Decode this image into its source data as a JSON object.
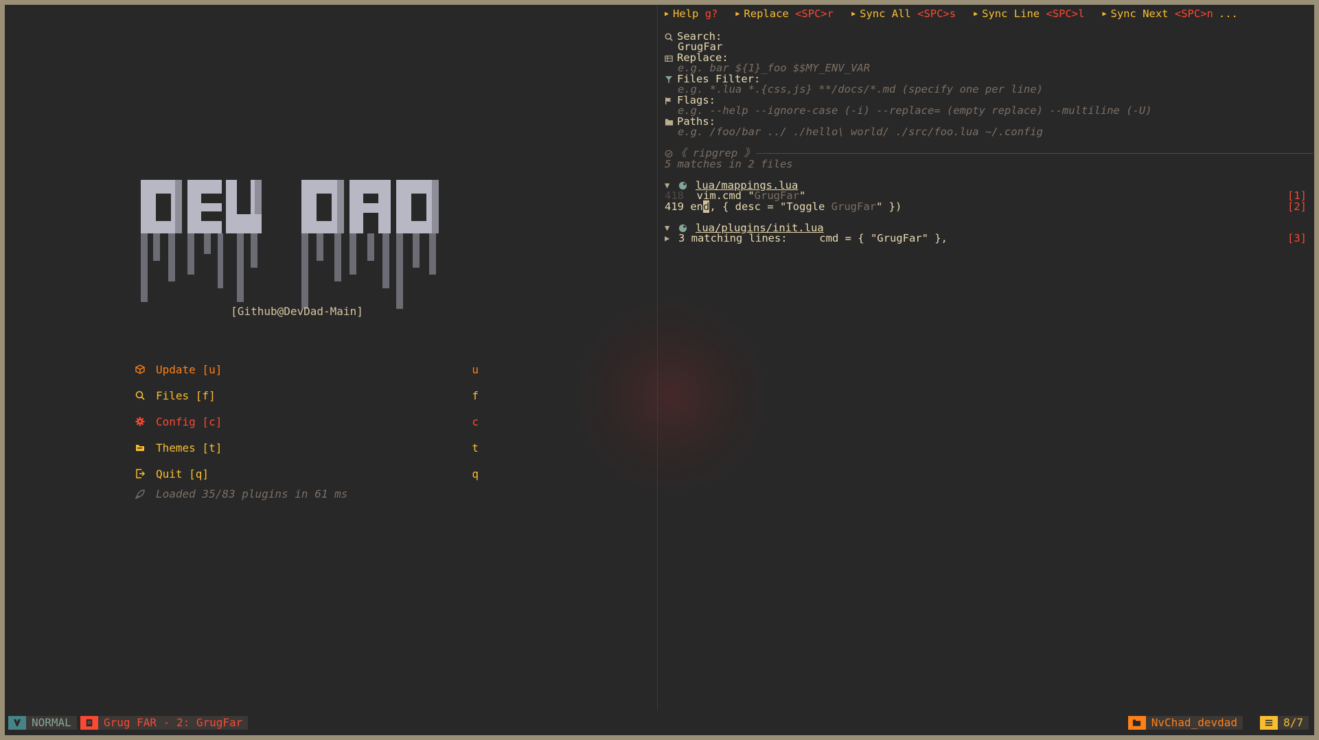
{
  "left": {
    "github_tag": "[Github@DevDad-Main]",
    "menu": [
      {
        "label": "Update [u]",
        "key": "u",
        "color": "#fe8019",
        "icon": "package-icon"
      },
      {
        "label": "Files [f]",
        "key": "f",
        "color": "#fabd2f",
        "icon": "search-icon"
      },
      {
        "label": "Config [c]",
        "key": "c",
        "color": "#fb4934",
        "icon": "gear-icon"
      },
      {
        "label": "Themes [t]",
        "key": "t",
        "color": "#fabd2f",
        "icon": "palette-icon"
      },
      {
        "label": "Quit [q]",
        "key": "q",
        "color": "#fabd2f",
        "icon": "exit-icon"
      }
    ],
    "loaded": "Loaded 35/83 plugins in 61 ms"
  },
  "right": {
    "topbar": [
      {
        "label": "Help",
        "key": "g?"
      },
      {
        "label": "Replace",
        "key": "<SPC>r"
      },
      {
        "label": "Sync All",
        "key": "<SPC>s"
      },
      {
        "label": "Sync Line",
        "key": "<SPC>l"
      },
      {
        "label": "Sync Next",
        "key": "<SPC>n"
      }
    ],
    "topbar_more": "...",
    "search_label": "Search:",
    "search_value": "GrugFar",
    "replace_label": "Replace:",
    "replace_placeholder": "e.g. bar   ${1}_foo   $$MY_ENV_VAR",
    "files_filter_label": "Files Filter:",
    "files_filter_placeholder": "e.g. *.lua   *.{css,js}   **/docs/*.md   (specify one per line)",
    "flags_label": "Flags:",
    "flags_placeholder": "e.g. --help --ignore-case (-i) --replace= (empty replace) --multiline (-U)",
    "paths_label": "Paths:",
    "paths_placeholder": "e.g. /foo/bar   ../   ./hello\\ world/   ./src/foo.lua   ~/.config",
    "engine_label": "《 ripgrep 》",
    "summary": "5 matches in 2 files",
    "files": [
      {
        "name": "lua/mappings.lua",
        "lines": [
          {
            "num": "418",
            "pre": "  vim.cmd \"",
            "match": "GrugFar",
            "post": "\"",
            "mark": "[1]"
          },
          {
            "num": "419",
            "pre": "en",
            "cursor": "d",
            "mid": ", { desc = \"Toggle ",
            "match": "GrugFar",
            "post": "\" })",
            "mark": "[2]"
          }
        ]
      },
      {
        "name": "lua/plugins/init.lua",
        "collapsed_text": "3 matching lines:     cmd = { \"GrugFar\" },",
        "mark": "[3]"
      }
    ]
  },
  "status": {
    "mode": "NORMAL",
    "buffer": "Grug FAR - 2: GrugFar",
    "cwd": "NvChad_devdad",
    "position": "8/7"
  }
}
